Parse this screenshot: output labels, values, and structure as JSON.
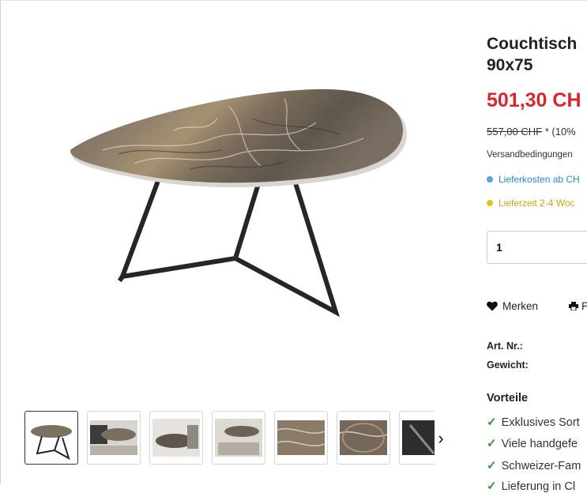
{
  "product": {
    "title_line1": "Couchtisch",
    "title_line2": "90x75",
    "price": "501,30 CH",
    "old_price": "557,00 CHF",
    "old_price_suffix": "* (10%",
    "shipping_link": "Versandbedingungen",
    "shipping_cost": "Lieferkosten ab CH",
    "delivery_time": "Lieferzeit 2-4 Woc",
    "quantity": "1",
    "wishlist_label": "Merken",
    "print_label": "P",
    "article_number_label": "Art. Nr.:",
    "weight_label": "Gewicht:"
  },
  "benefits": {
    "title": "Vorteile",
    "items": [
      "Exklusives Sort",
      "Viele handgefe",
      "Schweizer-Fam",
      "Lieferung in Cl"
    ]
  },
  "gallery": {
    "thumbnail_count": 7,
    "active_index": 0,
    "next_arrow": "›"
  },
  "colors": {
    "price_red": "#d8262e",
    "info_blue": "#2f86c6",
    "info_yellow": "#d3a315",
    "check_green": "#3b8f3b"
  },
  "icons": [
    "heart-icon",
    "printer-icon",
    "chevron-right-icon",
    "check-icon"
  ]
}
